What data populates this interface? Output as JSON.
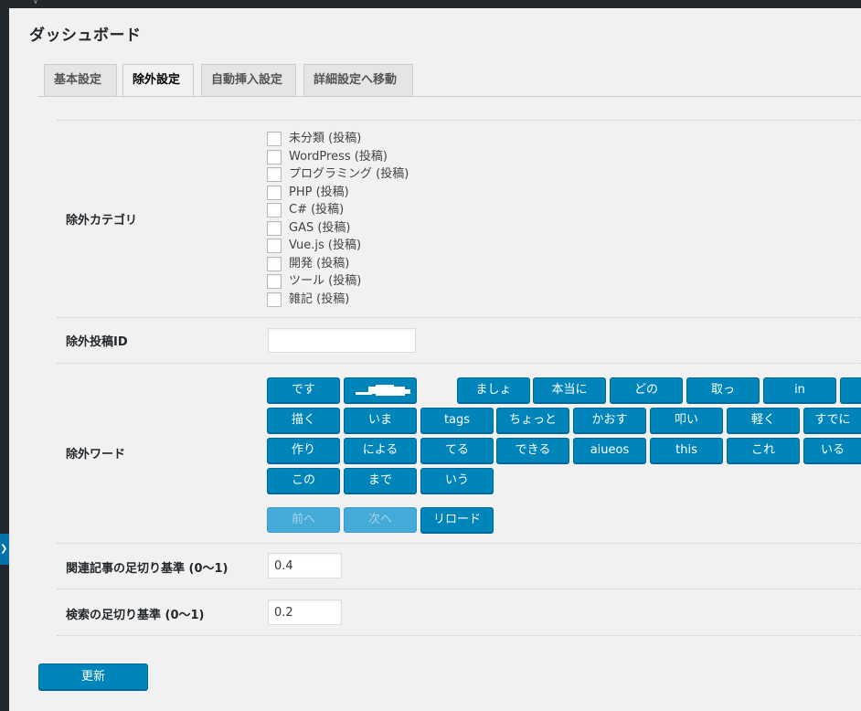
{
  "page": {
    "title": "ダッシュボード"
  },
  "tabs": [
    {
      "label": "基本設定",
      "active": false
    },
    {
      "label": "除外設定",
      "active": true
    },
    {
      "label": "自動挿入設定",
      "active": false
    },
    {
      "label": "詳細設定へ移動",
      "active": false
    }
  ],
  "exclude_category": {
    "label": "除外カテゴリ",
    "items": [
      {
        "label": "未分類 (投稿)",
        "checked": false
      },
      {
        "label": "WordPress (投稿)",
        "checked": false
      },
      {
        "label": "プログラミング (投稿)",
        "checked": false
      },
      {
        "label": "PHP (投稿)",
        "checked": false
      },
      {
        "label": "C# (投稿)",
        "checked": false
      },
      {
        "label": "GAS (投稿)",
        "checked": false
      },
      {
        "label": "Vue.js (投稿)",
        "checked": false
      },
      {
        "label": "開発 (投稿)",
        "checked": false
      },
      {
        "label": "ツール (投稿)",
        "checked": false
      },
      {
        "label": "雑記 (投稿)",
        "checked": false
      }
    ]
  },
  "exclude_post_id": {
    "label": "除外投稿ID",
    "value": ""
  },
  "exclude_words": {
    "label": "除外ワード",
    "rows": [
      [
        "です",
        "",
        "ましょ",
        "本当に",
        "どの",
        "取っ",
        "in"
      ],
      [
        "描く",
        "いま",
        "tags",
        "ちょっと",
        "かおす",
        "叩い",
        "軽く",
        "すでに"
      ],
      [
        "作り",
        "による",
        "てる",
        "できる",
        "aiueos",
        "this",
        "これ",
        "いる"
      ],
      [
        "この",
        "まで",
        "いう"
      ]
    ],
    "prev_label": "前へ",
    "next_label": "次へ",
    "reload_label": "リロード"
  },
  "related_threshold": {
    "label": "関連記事の足切り基準 (0〜1)",
    "value": "0.4"
  },
  "search_threshold": {
    "label": "検索の足切り基準 (0〜1)",
    "value": "0.2"
  },
  "submit_label": "更新",
  "colors": {
    "primary": "#0085ba",
    "primary_border": "#006799",
    "primary_disabled": "#44aad7",
    "admin_dark": "#23282d"
  }
}
